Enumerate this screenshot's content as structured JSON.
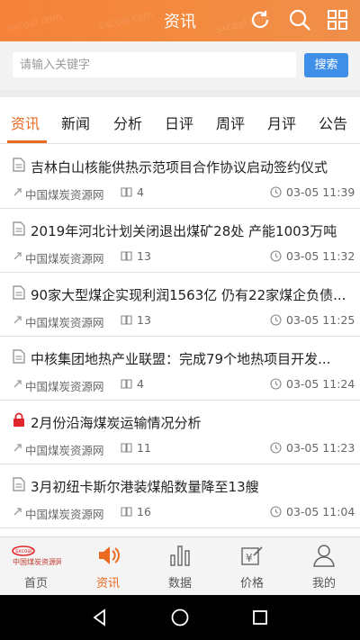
{
  "header": {
    "title": "资讯",
    "logo_text": "中国煤炭资源网 sxcoal.com",
    "icons": [
      "refresh-icon",
      "search-icon",
      "grid-menu-icon"
    ],
    "accent": "#f6823a"
  },
  "search": {
    "placeholder": "请输入关键字",
    "value": "",
    "button_label": "搜索",
    "button_color": "#3f8ee8"
  },
  "tabs": [
    {
      "label": "资讯",
      "active": true
    },
    {
      "label": "新闻",
      "active": false
    },
    {
      "label": "分析",
      "active": false
    },
    {
      "label": "日评",
      "active": false
    },
    {
      "label": "周评",
      "active": false
    },
    {
      "label": "月评",
      "active": false
    },
    {
      "label": "公告",
      "active": false
    }
  ],
  "articles": [
    {
      "title": "吉林白山核能供热示范项目合作协议启动签约仪式",
      "source": "中国煤炭资源网",
      "count": "4",
      "time": "03-05 11:39",
      "locked": false
    },
    {
      "title": "2019年河北计划关闭退出煤矿28处 产能1003万吨",
      "source": "中国煤炭资源网",
      "count": "13",
      "time": "03-05 11:32",
      "locked": false
    },
    {
      "title": "90家大型煤企实现利润1563亿 仍有22家煤企负债...",
      "source": "中国煤炭资源网",
      "count": "13",
      "time": "03-05 11:25",
      "locked": false
    },
    {
      "title": "中核集团地热产业联盟：完成79个地热项目开发...",
      "source": "中国煤炭资源网",
      "count": "4",
      "time": "03-05 11:24",
      "locked": false
    },
    {
      "title": "2月份沿海煤炭运输情况分析",
      "source": "中国煤炭资源网",
      "count": "11",
      "time": "03-05 11:23",
      "locked": true
    },
    {
      "title": "3月初纽卡斯尔港装煤船数量降至13艘",
      "source": "中国煤炭资源网",
      "count": "16",
      "time": "03-05 11:04",
      "locked": false
    }
  ],
  "bottom_nav": [
    {
      "label": "首页",
      "icon": "home-logo-icon",
      "active": false
    },
    {
      "label": "资讯",
      "icon": "speaker-icon",
      "active": true
    },
    {
      "label": "数据",
      "icon": "bar-chart-icon",
      "active": false
    },
    {
      "label": "价格",
      "icon": "price-tag-icon",
      "active": false
    },
    {
      "label": "我的",
      "icon": "user-icon",
      "active": false
    }
  ],
  "system_nav": [
    "back-icon",
    "home-icon",
    "recents-icon"
  ]
}
